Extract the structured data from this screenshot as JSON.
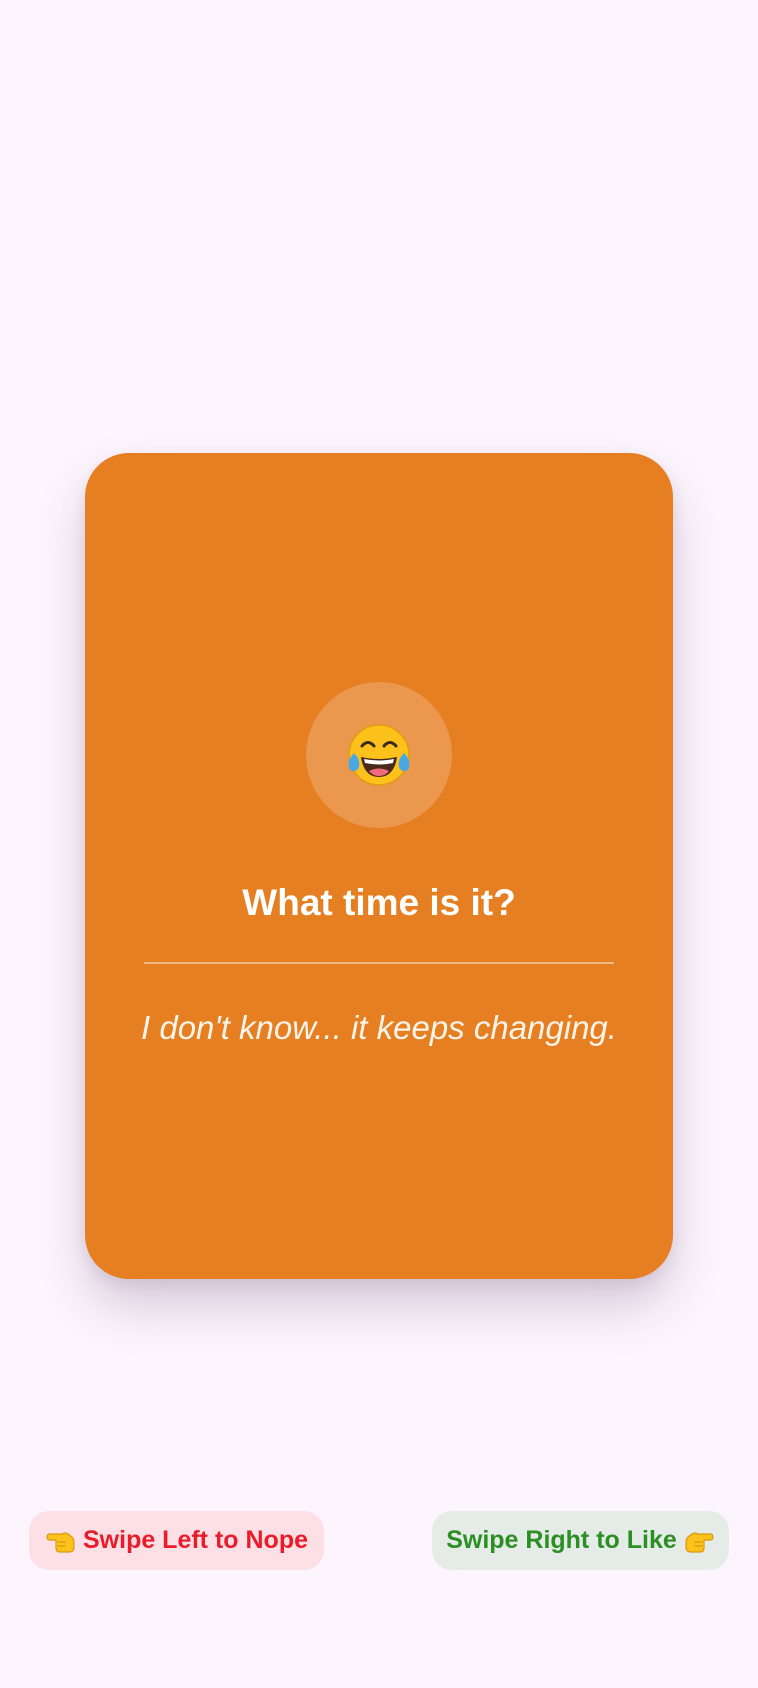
{
  "card": {
    "emoji_icon": "face-with-tears-of-joy-icon",
    "question": "What time is it?",
    "answer": "I don't know... it keeps changing.",
    "color": "#e67f22"
  },
  "hints": {
    "left_label": "Swipe Left to Nope",
    "left_icon": "pointing-left-hand-icon",
    "left_color": "#ea1c2a",
    "right_label": "Swipe Right to Like",
    "right_icon": "pointing-right-hand-icon",
    "right_color": "#2b8f24"
  }
}
